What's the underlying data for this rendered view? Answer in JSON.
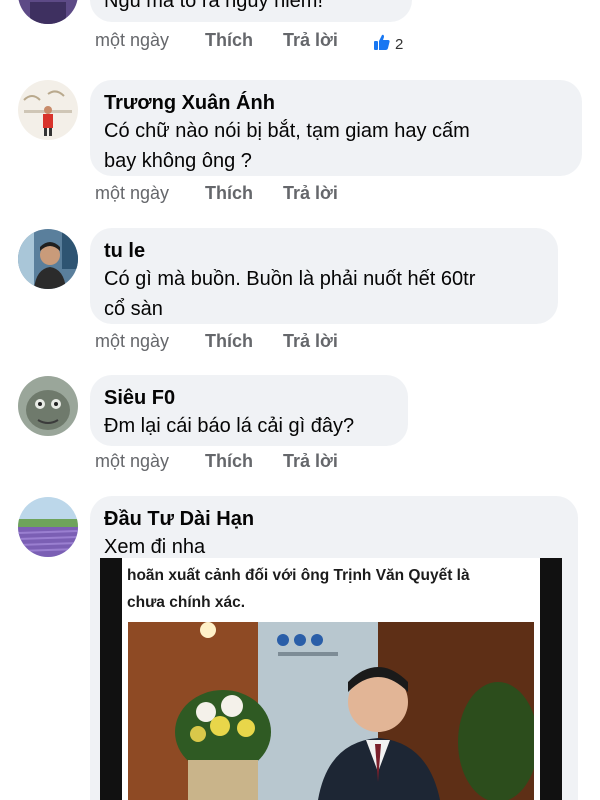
{
  "comments": [
    {
      "author": "",
      "text": "Ngủ mà tỏ ra nguy hiểm!",
      "time": "một ngày",
      "like_label": "Thích",
      "reply_label": "Trả lời",
      "reaction_count": "2",
      "reaction_icon": "thumbs-up-icon"
    },
    {
      "author": "Trương Xuân Ánh",
      "text_line1": "Có chữ nào nói bị bắt, tạm giam hay cấm",
      "text_line2": "bay không ông ?",
      "time": "một ngày",
      "like_label": "Thích",
      "reply_label": "Trả lời"
    },
    {
      "author": "tu le",
      "text_line1": "Có gì mà buồn. Buồn là phải nuốt hết 60tr",
      "text_line2": "cổ sàn",
      "time": "một ngày",
      "like_label": "Thích",
      "reply_label": "Trả lời"
    },
    {
      "author": "Siêu F0",
      "text": "Đm lại cái báo lá cải gì đây?",
      "time": "một ngày",
      "like_label": "Thích",
      "reply_label": "Trả lời"
    },
    {
      "author": "Đầu Tư Dài Hạn",
      "text": "Xem đi nha",
      "attachment": {
        "line1": "hoãn xuất cảnh đối với ông Trịnh Văn Quyết là",
        "line2": "chưa chính xác."
      }
    }
  ],
  "colors": {
    "bubble": "#f0f2f5",
    "meta": "#65676b",
    "like_blue": "#1877f2"
  }
}
